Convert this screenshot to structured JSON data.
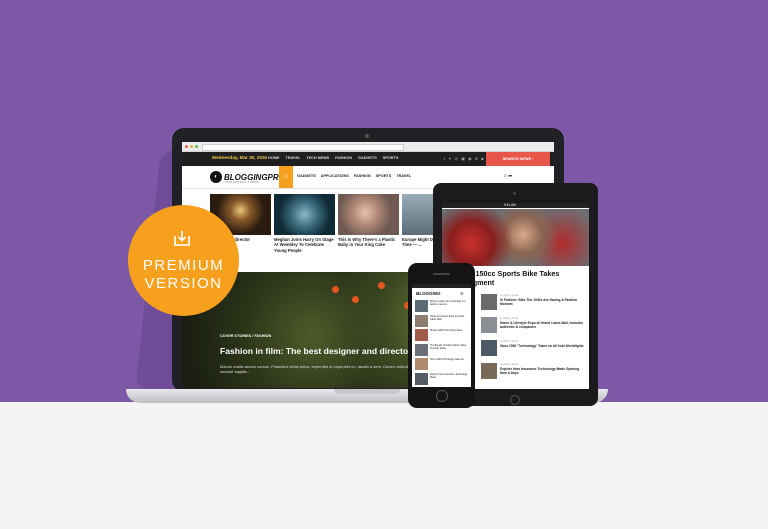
{
  "colors": {
    "background": "#7d58a6",
    "accent": "#f7a01e",
    "search": "#e8564a"
  },
  "badge": {
    "line1": "PREMIUM",
    "line2": "VERSION",
    "icon": "download-icon"
  },
  "laptop": {
    "topbar": {
      "date": "Wednesday, Mar 30, 2016",
      "nav": [
        "HOME",
        "TRAVEL",
        "TECH NEWS",
        "FASHION",
        "GADGETS",
        "SPORTS"
      ],
      "social": "f ✦ ◎ ▣ ◉ ✉ ▶",
      "search_button": "SEARCH NEWS ›"
    },
    "logo": {
      "name": "BLOGGINGPRO",
      "tagline": "WORDPRESS THEME"
    },
    "mainnav": {
      "home_icon": "home-icon",
      "links": [
        "GADGETS",
        "APPLICATIONS",
        "FASHION",
        "SPORTS",
        "TRAVEL"
      ]
    },
    "articles": [
      {
        "title": "...: The best director"
      },
      {
        "title": "Meghan Joins Harry On Stage At Wembley To Celebrate Young People"
      },
      {
        "title": "This Is Why There's a Plastic Baby in Your King Cake"
      },
      {
        "title": "Europe Might Dit... Savings Time — ..."
      }
    ],
    "hero": {
      "categories": "COVER STORIES / FASHION",
      "headline": "Fashion in film: The best designer and director colla",
      "excerpt": "Mauris mattis auctor cursus. Phasellus tellus tellus, imperdiet ut imperdiet eu, iaculis a sem. Donec vehicula vulputate porttitor condimentum, Proin viverra vel a leo suscipit sagittis..."
    }
  },
  "tablet": {
    "status": "9:41 AM",
    "headline_line1": "15 Naked 150cc Sports Bike Takes",
    "headline_line2": "muter Segment",
    "list": [
      {
        "meta": "by Admin Jones",
        "title": "In Fashion: Bike The 1930s Are Having A Fashion Moment"
      },
      {
        "meta": "by Admin Jones",
        "title": "Home & Lifestyle Expo at Grand Lakes Mall, includes authentic & companies"
      },
      {
        "meta": "by Admin Jones",
        "title": "Xbox 1080 'Technology' Takes on all Sold Worldlights"
      },
      {
        "meta": "by Admin Jones",
        "title": "Explore How Insurance Technology Made Opening Now a Days"
      }
    ]
  },
  "phone": {
    "logo": "BLOGGING",
    "list": [
      {
        "title": "Where motion are technology in a fashion moment"
      },
      {
        "title": "Home & Lifestyle Expo at Grand Lakes Mall"
      },
      {
        "title": "Shows 1080 Technology takes"
      },
      {
        "title": "The Benefit of Daily Fashion Wear Through Today"
      },
      {
        "title": "Xbox 1080 Technology takes all"
      },
      {
        "title": "Explore How Insurance Technology Made"
      }
    ]
  }
}
